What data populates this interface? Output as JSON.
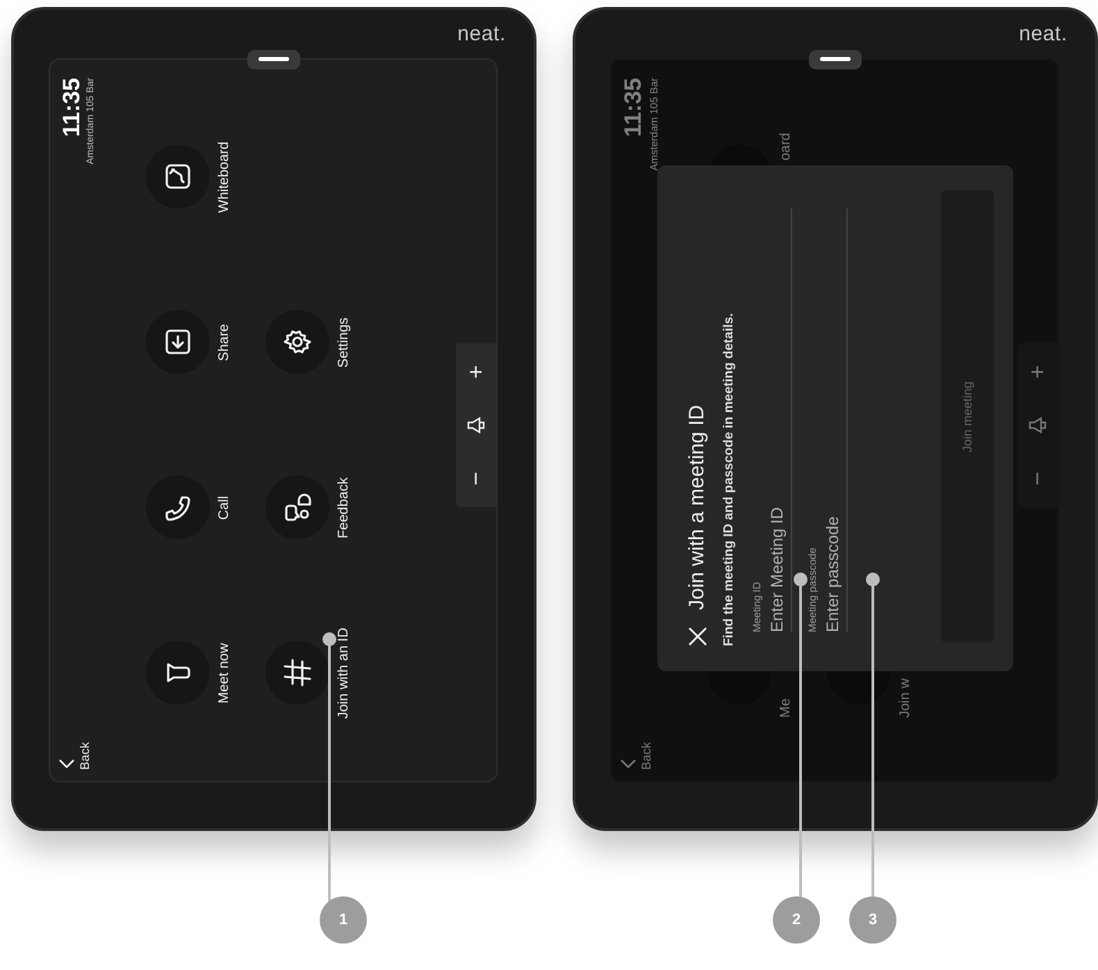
{
  "screens": [
    {
      "logo": "neat.",
      "home": {
        "dimmed": false,
        "back": "Back",
        "time": "11:35",
        "location": "Amsterdam 105 Bar",
        "tile_rows": [
          [
            {
              "kind": "meet",
              "label": "Meet now"
            },
            {
              "kind": "call",
              "label": "Call"
            },
            {
              "kind": "share",
              "label": "Share"
            },
            {
              "kind": "whiteboard",
              "label": "Whiteboard"
            }
          ],
          [
            {
              "kind": "join",
              "label": "Join with an ID"
            },
            {
              "kind": "feedback",
              "label": "Feedback"
            },
            {
              "kind": "settings",
              "label": "Settings"
            }
          ]
        ],
        "volume": {
          "minus": "−",
          "plus": "+"
        }
      }
    },
    {
      "logo": "neat.",
      "home": {
        "dimmed": true,
        "back": "Back",
        "time": "11:35",
        "location": "Amsterdam 105 Bar",
        "tile_rows": [
          [
            {
              "label": "Me",
              "cut_start": false
            },
            null,
            null,
            {
              "label": "oard",
              "cut_start": true
            }
          ],
          [
            {
              "label": "Join w",
              "cut_start": false
            },
            null,
            null
          ]
        ],
        "volume": {
          "minus": "−",
          "plus": "+"
        }
      },
      "dialog": {
        "title": "Join with a meeting ID",
        "subtitle": "Find the meeting ID and passcode in meeting details.",
        "fields": [
          {
            "label": "Meeting ID",
            "placeholder": "Enter Meeting ID"
          },
          {
            "label": "Meeting passcode",
            "placeholder": "Enter passcode"
          }
        ],
        "button": {
          "label": "Join meeting",
          "disabled": true
        }
      }
    }
  ],
  "callouts": [
    {
      "number": "1"
    },
    {
      "number": "2"
    },
    {
      "number": "3"
    }
  ]
}
